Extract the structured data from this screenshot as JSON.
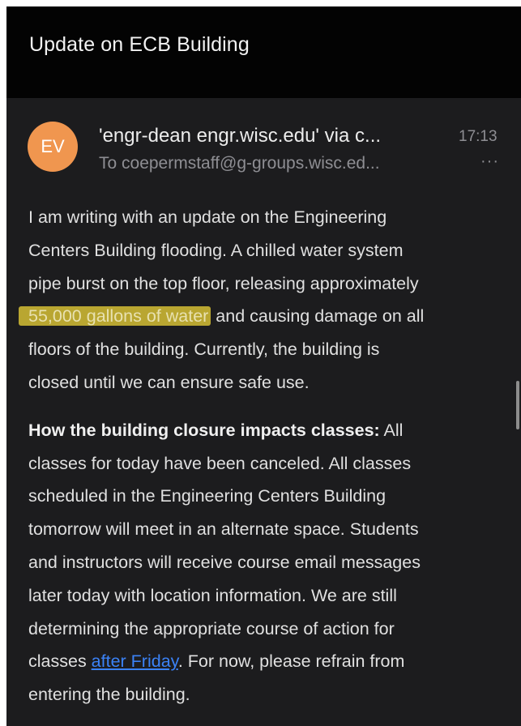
{
  "header": {
    "title": "Update on ECB Building"
  },
  "message": {
    "avatar_initials": "EV",
    "sender": "'engr-dean engr.wisc.edu' via c...",
    "time": "17:13",
    "recipient": "To coepermstaff@g-groups.wisc.ed...",
    "more": "···"
  },
  "body": {
    "p1": {
      "l1": "I am writing with an update on the Engineering",
      "l2": "Centers Building flooding. A chilled water system",
      "l3": "pipe burst on the top floor, releasing approximately",
      "l4_highlight": "55,000 gallons of water",
      "l4_rest": " and causing damage on all",
      "l5": "floors of the building. Currently, the building is",
      "l6": "closed until we can ensure safe use."
    },
    "p2": {
      "bold": "How the building closure impacts classes:",
      "l1_rest": " All",
      "l2": "classes for today have been canceled. All classes",
      "l3": "scheduled in the Engineering Centers Building",
      "l4": "tomorrow will meet in an alternate space. Students",
      "l5": "and instructors will receive course email messages",
      "l6": "later today with location information.  We are still",
      "l7": "determining the appropriate course of action for",
      "l8_pre": "classes ",
      "l8_link": "after Friday",
      "l8_post": ". For now, please refrain from",
      "l9": "entering the building."
    }
  },
  "colors": {
    "background": "#1c1c1e",
    "header": "#030303",
    "avatar": "#f0964f",
    "highlight": "#b9a631",
    "link": "#3b82f6"
  }
}
